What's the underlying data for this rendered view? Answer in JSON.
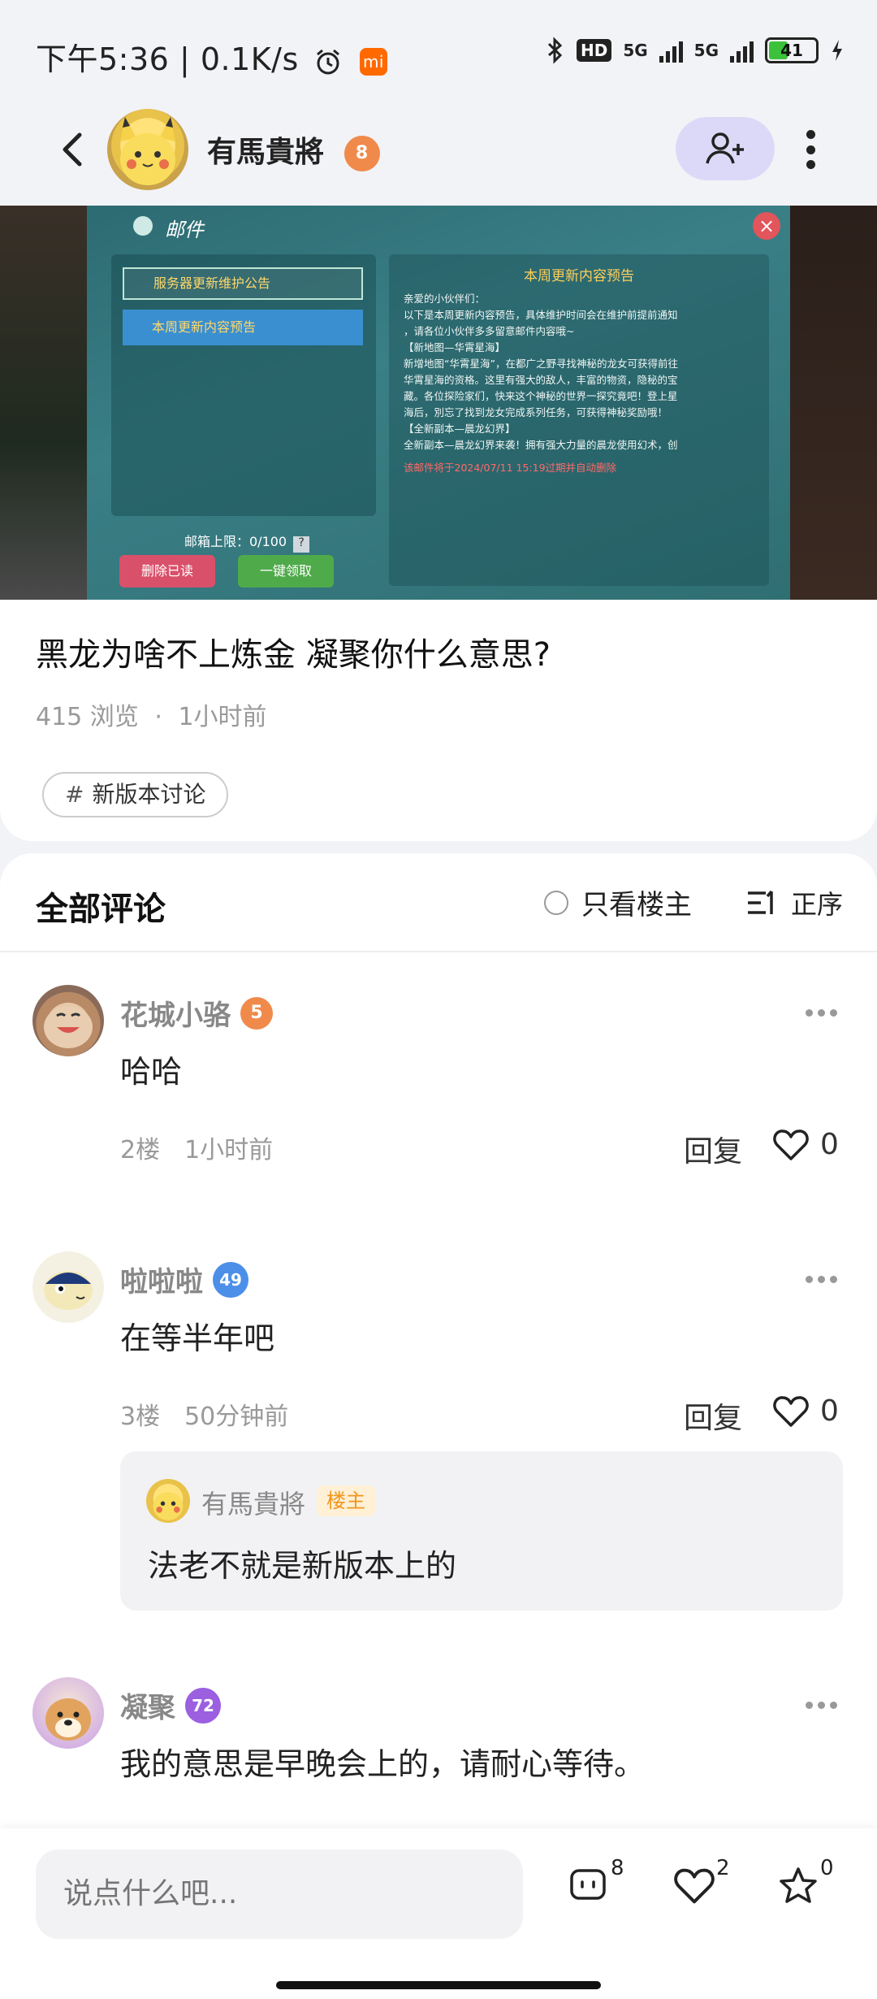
{
  "status_bar": {
    "time": "下午5:36",
    "net_speed": "0.1K/s",
    "hd_label": "HD",
    "signal1": "5G",
    "signal2": "5G",
    "battery": "41",
    "battery_level": 0.41
  },
  "header": {
    "author_name": "有馬貴將",
    "author_level": "8"
  },
  "post": {
    "image": {
      "window_title": "邮件",
      "list_item_1": "服务器更新维护公告",
      "list_item_2": "本周更新内容预告",
      "mailbox_limit": "邮箱上限：0/100",
      "help": "?",
      "delete_read": "删除已读",
      "claim_all": "一键领取",
      "content_title": "本周更新内容预告",
      "content_lines": [
        "亲爱的小伙伴们：",
        "以下是本周更新内容预告，具体维护时间会在维护前提前通知",
        "，请各位小伙伴多多留意邮件内容哦~",
        "【新地图—华霄星海】",
        "新增地图“华霄星海”，在都广之野寻找神秘的龙女可获得前往",
        "华霄星海的资格。这里有强大的敌人，丰富的物资，隐秘的宝",
        "藏。各位探险家们，快来这个神秘的世界一探究竟吧！登上星",
        "海后，別忘了找到龙女完成系列任务，可获得神秘奖励哦！",
        "【全新副本—晨龙幻界】",
        "全新副本—晨龙幻界来袭！拥有强大力量的晨龙使用幻术，创"
      ],
      "expire_note": "该邮件将于2024/07/11 15:19过期并自动删除"
    },
    "title": "黑龙为啥不上炼金 凝聚你什么意思?",
    "views": "415 浏览",
    "dot": "·",
    "time": "1小时前",
    "tag_hash": "#",
    "tag": "新版本讨论"
  },
  "comments": {
    "title": "全部评论",
    "only_host": "只看楼主",
    "sort": "正序",
    "items": [
      {
        "name": "花城小骆",
        "level": "5",
        "text": "哈哈",
        "floor": "2楼",
        "time": "1小时前",
        "reply": "回复",
        "likes": "0"
      },
      {
        "name": "啦啦啦",
        "level": "49",
        "text": "在等半年吧",
        "floor": "3楼",
        "time": "50分钟前",
        "reply": "回复",
        "likes": "0",
        "quote": {
          "name": "有馬貴將",
          "badge": "楼主",
          "text": "法老不就是新版本上的"
        }
      },
      {
        "name": "凝聚",
        "level": "72",
        "text": "我的意思是早晚会上的，请耐心等待。"
      }
    ]
  },
  "bottom": {
    "placeholder": "说点什么吧...",
    "comment_count": "8",
    "like_count": "2",
    "fav_count": "0"
  },
  "colors": {
    "accent_follow": "#dcd9f8",
    "level_orange": "#f08a4b",
    "level_blue": "#4b8fe8",
    "level_purple": "#9b5fe0",
    "host_badge": "#f0961e"
  }
}
